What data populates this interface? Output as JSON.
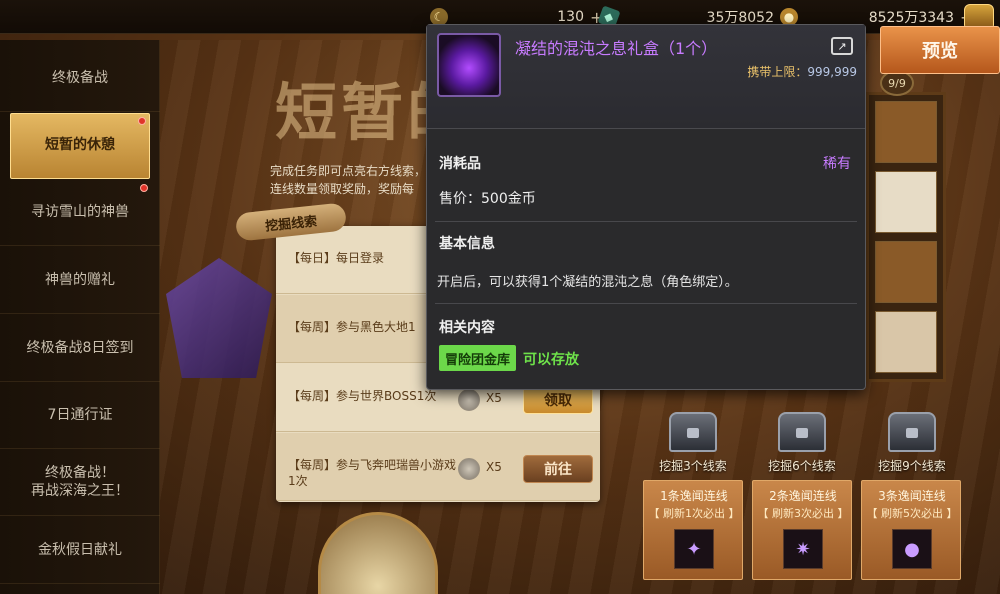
{
  "currency": {
    "c1": {
      "icon": "moon-coin-icon",
      "value": "130",
      "plus": "+"
    },
    "c2": {
      "icon": "crystal-icon",
      "value": "35万8052",
      "plus": "+"
    },
    "c3": {
      "icon": "gold-coin-icon",
      "value": "8525万3343",
      "plus": "+"
    }
  },
  "sidebar": {
    "items": [
      {
        "label": "终极备战"
      },
      {
        "label": "短暂的休憩"
      },
      {
        "label": "寻访雪山的神兽"
      },
      {
        "label": "神兽的赠礼"
      },
      {
        "label": "终极备战8日签到"
      },
      {
        "label": "7日通行证"
      },
      {
        "label": "终极备战！\n再战深海之王！"
      },
      {
        "label": "金秋假日献礼"
      }
    ]
  },
  "banner": {
    "title": "短暂的",
    "desc": "完成任务即可点亮右方线索，连线数量领取奖励，奖励每",
    "clue_label": "挖掘线索"
  },
  "tasks": [
    {
      "text": "【每日】每日登录",
      "count": "",
      "button": ""
    },
    {
      "text": "【每周】参与黑色大地1",
      "count": "",
      "button": ""
    },
    {
      "text": "【每周】参与世界BOSS1次",
      "count": "X5",
      "button": "领取"
    },
    {
      "text": "【每周】参与飞奔吧瑞兽小游戏1次",
      "count": "X5",
      "button": "前往"
    }
  ],
  "grid_cap": "9/9",
  "chests": [
    {
      "label": "挖掘3个线索"
    },
    {
      "label": "挖掘6个线索"
    },
    {
      "label": "挖掘9个线索"
    }
  ],
  "cards": [
    {
      "title": "1条逸闻连线",
      "sub": "【 刷新1次必出 】"
    },
    {
      "title": "2条逸闻连线",
      "sub": "【 刷新3次必出 】"
    },
    {
      "title": "3条逸闻连线",
      "sub": "【 刷新5次必出 】"
    }
  ],
  "preview_button": "预览",
  "tooltip": {
    "name": "凝结的混沌之息礼盒（1个）",
    "limit_label": "携带上限：",
    "limit_value": "999,999",
    "type": "消耗品",
    "rarity": "稀有",
    "price": "售价：500金币",
    "basic_header": "基本信息",
    "basic_text": "开启后，可以获得1个凝结的混沌之息（角色绑定）。",
    "related_header": "相关内容",
    "tag": "冒险团金库",
    "store_text": "可以存放"
  },
  "colors": {
    "rarity_purple": "#c77bff",
    "limit_gold": "#e9c16a",
    "store_green": "#6ee24a",
    "sidebar_active": "#e4b862"
  }
}
